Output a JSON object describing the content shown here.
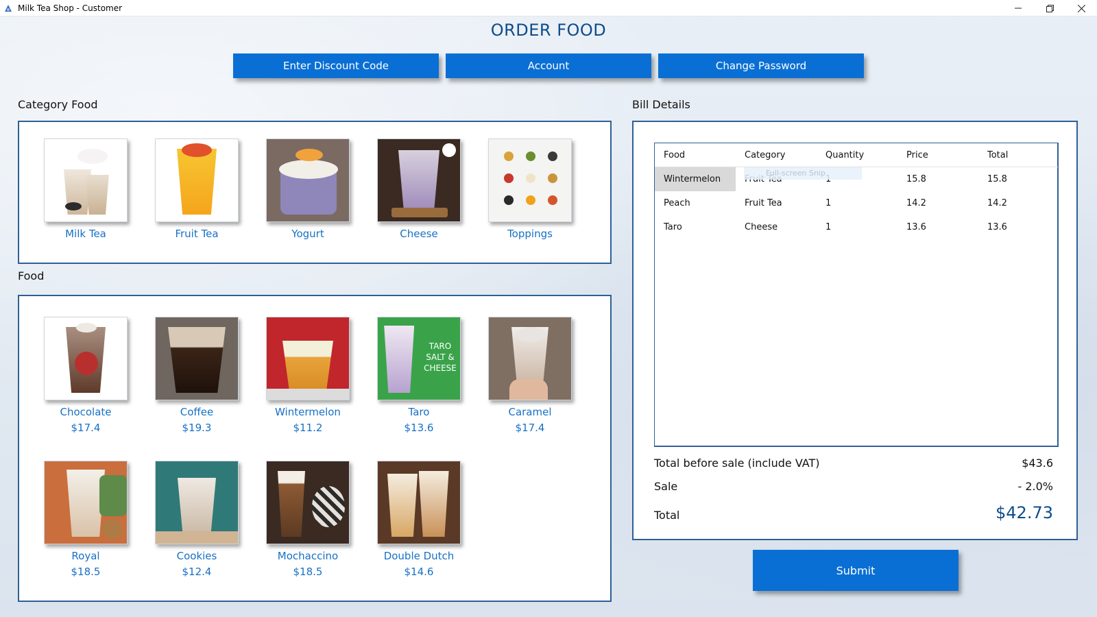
{
  "window": {
    "title": "Milk Tea Shop - Customer",
    "controls": [
      "minimize-icon",
      "restore-icon",
      "close-icon"
    ]
  },
  "page_title": "ORDER FOOD",
  "toolbar": {
    "discount_label": "Enter Discount Code",
    "account_label": "Account",
    "password_label": "Change Password"
  },
  "category_section": {
    "label": "Category Food",
    "items": [
      {
        "name": "Milk Tea"
      },
      {
        "name": "Fruit Tea"
      },
      {
        "name": "Yogurt"
      },
      {
        "name": "Cheese"
      },
      {
        "name": "Toppings"
      }
    ]
  },
  "food_section": {
    "label": "Food",
    "items": [
      {
        "name": "Chocolate",
        "price": "$17.4"
      },
      {
        "name": "Coffee",
        "price": "$19.3"
      },
      {
        "name": "Wintermelon",
        "price": "$11.2"
      },
      {
        "name": "Taro",
        "price": "$13.6",
        "image_text": "TARO SALT & CHEESE"
      },
      {
        "name": "Caramel",
        "price": "$17.4"
      },
      {
        "name": "Royal",
        "price": "$18.5"
      },
      {
        "name": "Cookies",
        "price": "$12.4"
      },
      {
        "name": "Mochaccino",
        "price": "$18.5"
      },
      {
        "name": "Double Dutch",
        "price": "$14.6"
      }
    ]
  },
  "bill": {
    "label": "Bill Details",
    "columns": [
      "Food",
      "Category",
      "Quantity",
      "Price",
      "Total"
    ],
    "rows": [
      {
        "food": "Wintermelon",
        "category": "Fruit Tea",
        "quantity": "1",
        "price": "15.8",
        "total": "15.8"
      },
      {
        "food": "Peach",
        "category": "Fruit Tea",
        "quantity": "1",
        "price": "14.2",
        "total": "14.2"
      },
      {
        "food": "Taro",
        "category": "Cheese",
        "quantity": "1",
        "price": "13.6",
        "total": "13.6"
      }
    ],
    "overlay_tooltip": "Full-screen Snip",
    "total_before_label": "Total before sale (include VAT)",
    "total_before_value": "$43.6",
    "sale_label": "Sale",
    "sale_value": "- 2.0%",
    "total_label": "Total",
    "total_value": "$42.73"
  },
  "submit_label": "Submit",
  "colors": {
    "accent": "#0a6fd4",
    "title": "#0f4c8a",
    "link": "#1670c5",
    "panel_border": "#2f5f95",
    "selected_row": "#d9d9d9"
  }
}
